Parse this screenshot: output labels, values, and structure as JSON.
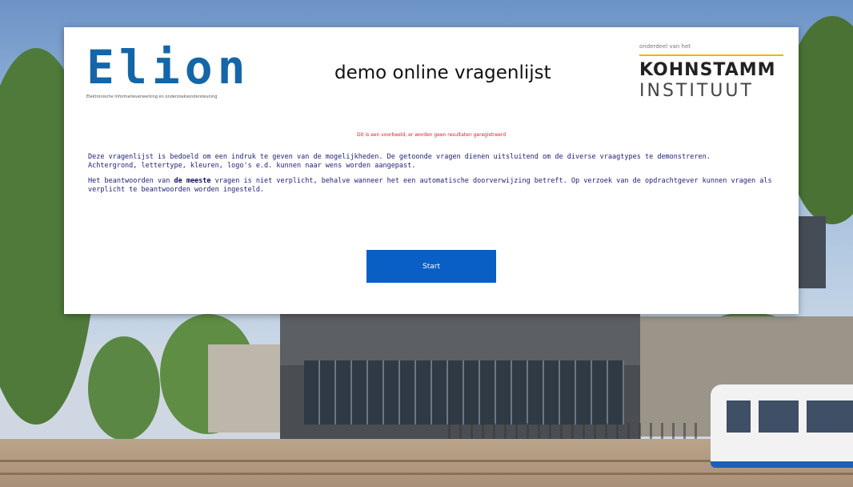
{
  "header": {
    "logo_left_text": "Elion",
    "logo_left_tagline": "Elektronische Informatieverwerking en onderzoeksondersteuning",
    "title": "demo online vragenlijst",
    "logo_right_sub": "onderdeel van het",
    "logo_right_line1": "KOHNSTAMM",
    "logo_right_line2": "INSTITUUT"
  },
  "notice": "Dit is een voorbeeld, er worden geen resultaten geregistreerd",
  "intro": {
    "p1_line1": "Deze vragenlijst is bedoeld om een indruk te geven van de mogelijkheden. De getoonde vragen dienen uitsluitend om de diverse vraagtypes te demonstreren.",
    "p1_line2": "Achtergrond, lettertype, kleuren, logo's e.d. kunnen naar wens worden aangepast.",
    "p2_before": "Het beantwoorden van ",
    "p2_bold": "de meeste",
    "p2_after": " vragen is niet verplicht, behalve wanneer het een automatische doorverwijzing betreft. Op verzoek van de opdrachtgever kunnen vragen als verplicht te beantwoorden worden ingesteld."
  },
  "start_button": "Start",
  "colors": {
    "accent": "#0a5fc6",
    "logo_blue": "#1466a8",
    "notice_red": "#e02020",
    "kohnstamm_line": "#f0b400"
  }
}
